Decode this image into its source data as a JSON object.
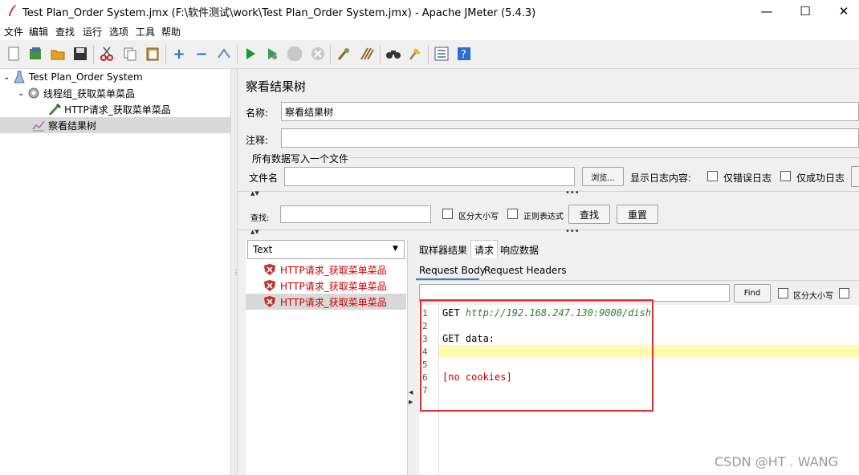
{
  "window": {
    "title": "Test Plan_Order System.jmx (F:\\软件测试\\work\\Test Plan_Order System.jmx) - Apache JMeter (5.4.3)",
    "minimize": "—",
    "maximize": "☐",
    "close": "✕"
  },
  "menu": [
    "文件",
    "编辑",
    "查找",
    "运行",
    "选项",
    "工具",
    "帮助"
  ],
  "tree": {
    "test_plan": "Test Plan_Order System",
    "thread_group": "线程组_获取菜单菜品",
    "http_request": "HTTP请求_获取菜单菜品",
    "listener": "察看结果树"
  },
  "panel": {
    "title": "察看结果树",
    "name_label": "名称:",
    "name_value": "察看结果树",
    "comment_label": "注释:",
    "comment_value": "",
    "file_section": "所有数据写入一个文件",
    "filename_label": "文件名",
    "filename_value": "",
    "browse": "浏览...",
    "log_label": "显示日志内容:",
    "errors_only": "仅错误日志",
    "success_only": "仅成功日志"
  },
  "search": {
    "label": "查找:",
    "value": "",
    "case_sensitive": "区分大小写",
    "regex": "正则表达式",
    "find_button": "查找",
    "reset_button": "重置"
  },
  "renderer": {
    "selected": "Text"
  },
  "results": [
    "HTTP请求_获取菜单菜品",
    "HTTP请求_获取菜单菜品",
    "HTTP请求_获取菜单菜品"
  ],
  "tabs": {
    "sampler_result": "取样器结果",
    "request": "请求",
    "response": "响应数据"
  },
  "subtabs": {
    "body": "Request Body",
    "headers": "Request Headers"
  },
  "body_find": {
    "value": "",
    "button": "Find",
    "case_sensitive": "区分大小写"
  },
  "editor": {
    "line_numbers": [
      "1",
      "2",
      "3",
      "4",
      "5",
      "6",
      "7"
    ],
    "line1_method": "GET ",
    "line1_url": "http://192.168.247.130:9000/dish",
    "line3": "GET data:",
    "line6": "[no cookies]"
  },
  "watermark": "CSDN @HT . WANG",
  "colors": {
    "highlight_line": "#fffab0",
    "url": "#2a7d2a",
    "cookies": "#c00000",
    "annotation_box": "#e03030"
  }
}
